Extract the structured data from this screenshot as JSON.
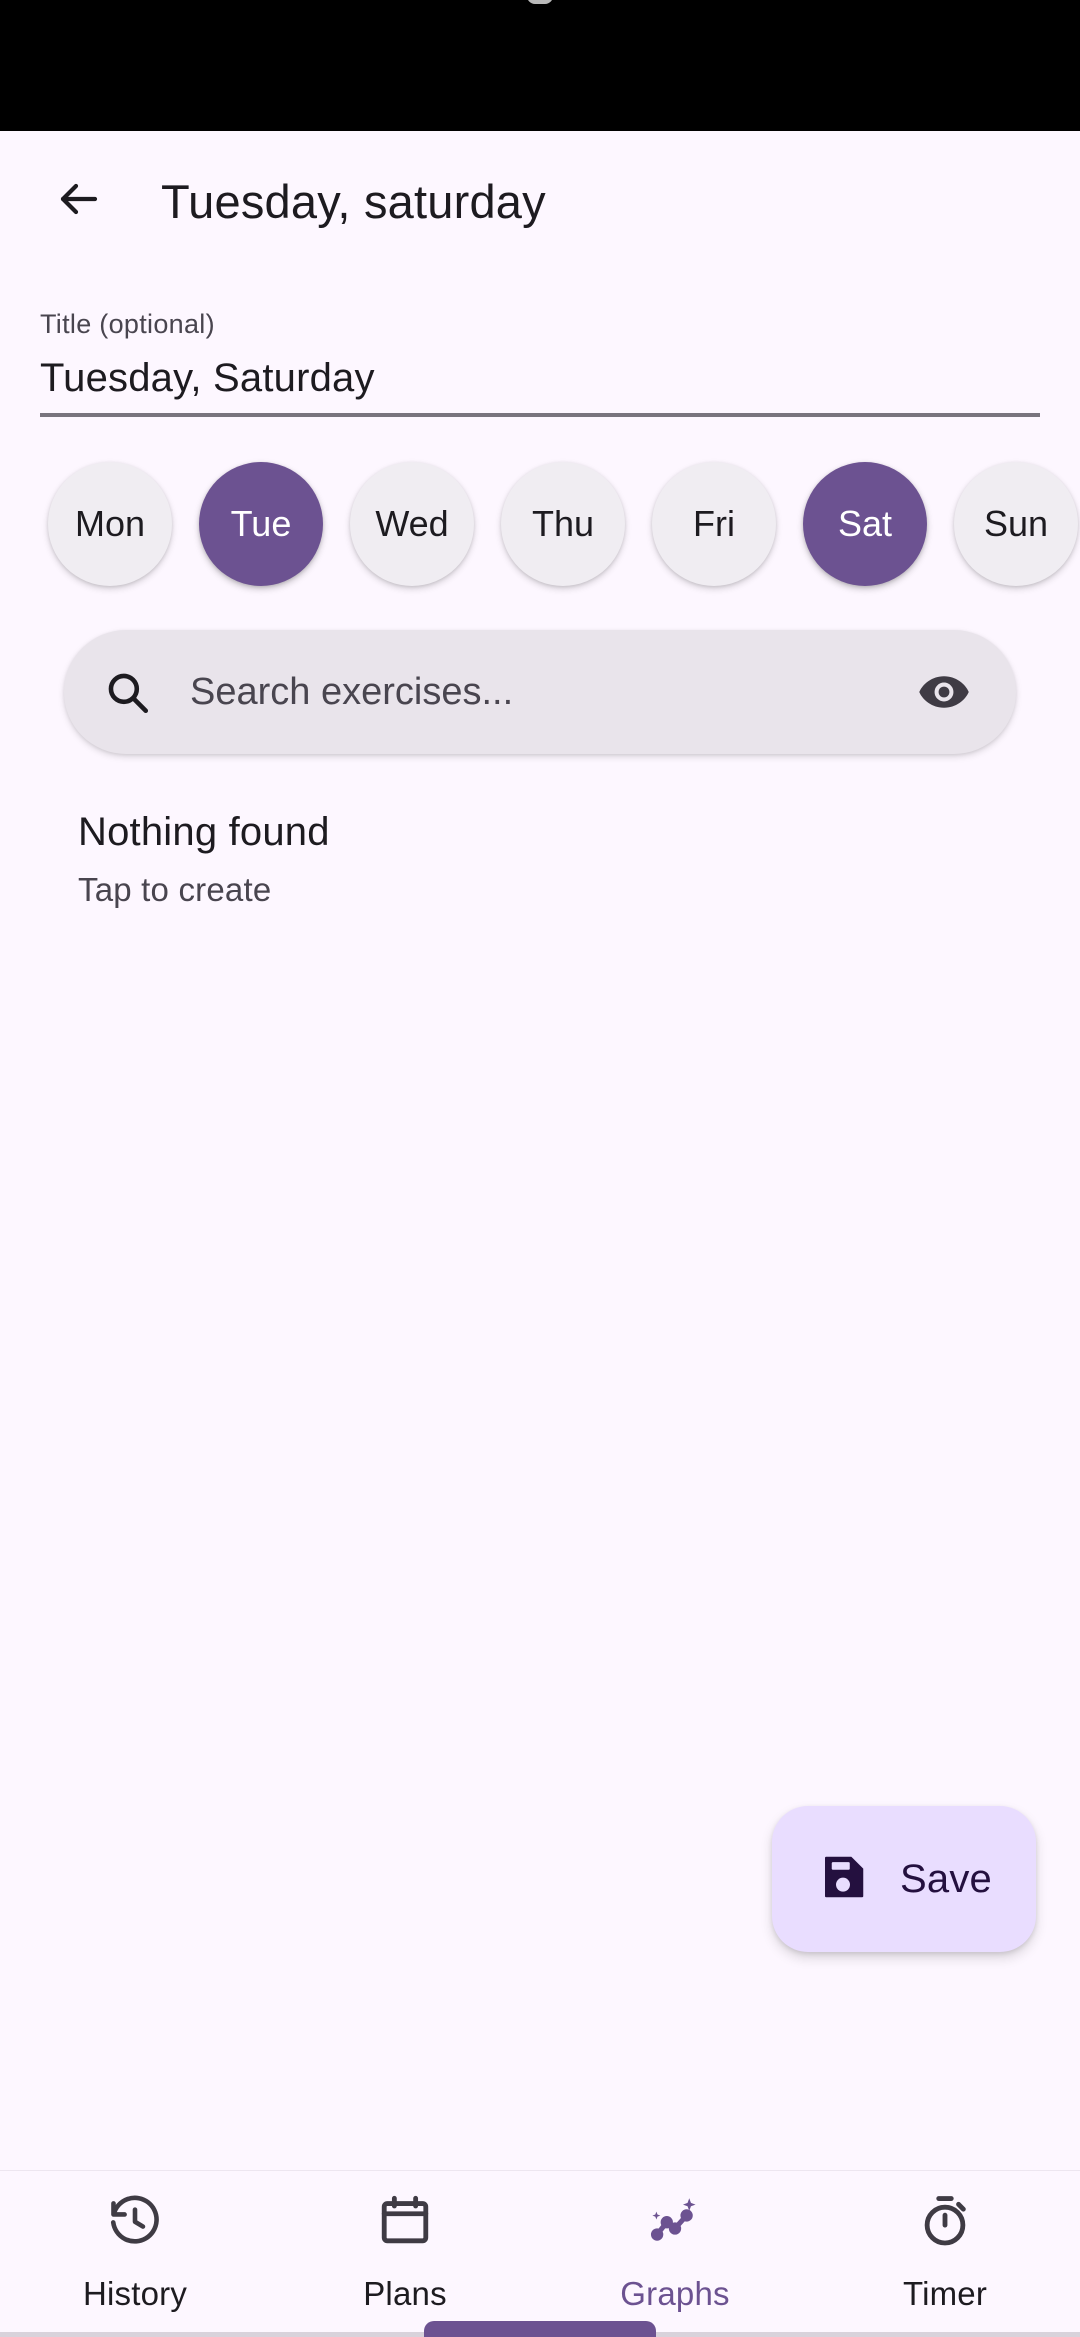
{
  "appbar": {
    "back_icon": "arrow-left-icon",
    "title": "Tuesday, saturday"
  },
  "title_field": {
    "label": "Title (optional)",
    "value": "Tuesday, Saturday"
  },
  "days": [
    {
      "label": "Mon",
      "selected": false
    },
    {
      "label": "Tue",
      "selected": true
    },
    {
      "label": "Wed",
      "selected": false
    },
    {
      "label": "Thu",
      "selected": false
    },
    {
      "label": "Fri",
      "selected": false
    },
    {
      "label": "Sat",
      "selected": true
    },
    {
      "label": "Sun",
      "selected": false
    }
  ],
  "search": {
    "icon": "search-icon",
    "placeholder": "Search exercises...",
    "value": "",
    "trailing_icon": "eye-icon"
  },
  "results": {
    "empty_title": "Nothing found",
    "empty_subtitle": "Tap to create"
  },
  "fab": {
    "icon": "floppy-disk-save-icon",
    "label": "Save"
  },
  "bottom_nav": [
    {
      "label": "History",
      "icon": "history-clock-icon",
      "active": false
    },
    {
      "label": "Plans",
      "icon": "calendar-icon",
      "active": false
    },
    {
      "label": "Graphs",
      "icon": "insights-chart-icon",
      "active": true
    },
    {
      "label": "Timer",
      "icon": "stopwatch-icon",
      "active": false
    }
  ],
  "colors": {
    "background": "#FDF7FF",
    "accent": "#6C5291",
    "chip_unselected": "#F0EDF2",
    "search_background": "#E9E4EB",
    "fab_background": "#E9DDFF",
    "fab_text": "#24103F",
    "statusbar": "#000000"
  }
}
